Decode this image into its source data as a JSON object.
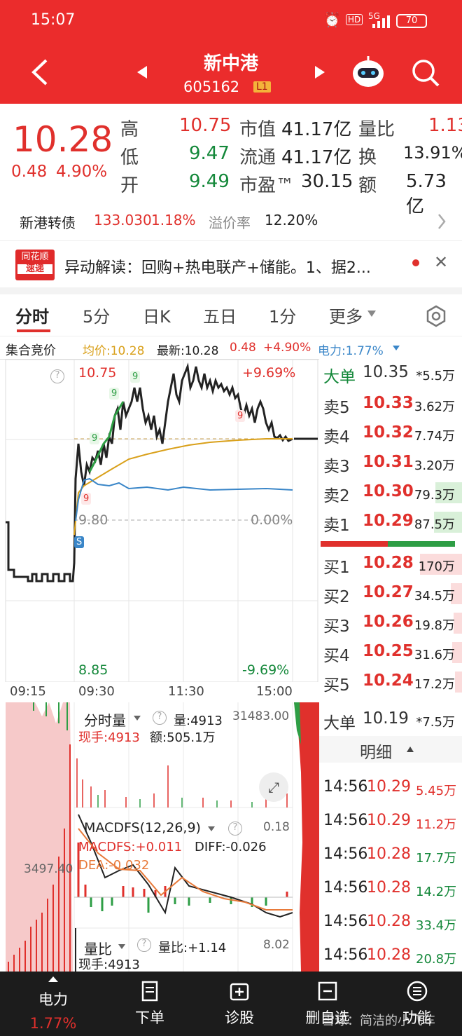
{
  "status": {
    "time": "15:07",
    "hd": "HD",
    "net": "5G",
    "battery": "70"
  },
  "nav": {
    "name": "新中港",
    "code": "605162",
    "level": "L1"
  },
  "quote": {
    "price": "10.28",
    "change": "0.48",
    "pct": "4.90%",
    "high_l": "高",
    "high": "10.75",
    "low_l": "低",
    "low": "9.47",
    "open_l": "开",
    "open": "9.49",
    "mcap_l": "市值",
    "mcap": "41.17亿",
    "float_l": "流通",
    "float": "41.17亿",
    "pe_l": "市盈™",
    "pe": "30.15",
    "vr_l": "量比",
    "vr": "1.13",
    "turn_l": "换",
    "turn": "13.91%",
    "amt_l": "额",
    "amt": "5.73亿"
  },
  "cb": {
    "name": "新港转债",
    "price": "133.030",
    "pct": "1.18%",
    "prem_l": "溢价率",
    "prem": "12.20%"
  },
  "news": {
    "logo1": "同花顺",
    "logo2": "速递",
    "text": "异动解读：回购+热电联产+储能。1、据2..."
  },
  "tabs": [
    "分时",
    "5分",
    "日K",
    "五日",
    "1分",
    "更多"
  ],
  "info": {
    "auction": "集合竞价",
    "avg": "均价:10.28",
    "last": "最新:10.28",
    "chg": "0.48",
    "pct": "+4.90%",
    "power": "电力:1.77%"
  },
  "chart": {
    "high": "10.75",
    "high_pct": "+9.69%",
    "pre": "9.80",
    "pre_pct": "0.00%",
    "low": "8.85",
    "low_pct": "-9.69%",
    "t": [
      "09:15",
      "09:30",
      "11:30",
      "15:00"
    ]
  },
  "vol": {
    "title": "分时量",
    "vol": "量:4913",
    "vmax": "31483.00",
    "hand": "现手:4913",
    "amt": "额:505.1万"
  },
  "macd": {
    "title": "MACDFS(12,26,9)",
    "top": "0.18",
    "macd": "MACDFS:+0.011",
    "diff": "DIFF:-0.026",
    "dea": "DEA:-0.032"
  },
  "vr": {
    "title": "量比",
    "val": "量比:+1.14",
    "top": "8.02",
    "hand": "现手:4913",
    "left": "3497.40"
  },
  "book": {
    "big_sell": {
      "label": "大单",
      "price": "10.35",
      "vol": "*5.5万"
    },
    "asks": [
      {
        "l": "卖5",
        "p": "10.33",
        "v": "3.62万"
      },
      {
        "l": "卖4",
        "p": "10.32",
        "v": "7.74万"
      },
      {
        "l": "卖3",
        "p": "10.31",
        "v": "3.20万"
      },
      {
        "l": "卖2",
        "p": "10.30",
        "v": "79.3万"
      },
      {
        "l": "卖1",
        "p": "10.29",
        "v": "87.5万"
      }
    ],
    "bids": [
      {
        "l": "买1",
        "p": "10.28",
        "v": "170万"
      },
      {
        "l": "买2",
        "p": "10.27",
        "v": "34.5万"
      },
      {
        "l": "买3",
        "p": "10.26",
        "v": "19.8万"
      },
      {
        "l": "买4",
        "p": "10.25",
        "v": "31.6万"
      },
      {
        "l": "买5",
        "p": "10.24",
        "v": "17.2万"
      }
    ],
    "big_buy": {
      "label": "大单",
      "price": "10.19",
      "vol": "*7.5万"
    },
    "detail": "明细",
    "trades": [
      {
        "t": "14:56",
        "p": "10.29",
        "v": "5.45万"
      },
      {
        "t": "14:56",
        "p": "10.29",
        "v": "11.2万"
      },
      {
        "t": "14:56",
        "p": "10.28",
        "v": "17.7万"
      },
      {
        "t": "14:56",
        "p": "10.28",
        "v": "14.2万"
      },
      {
        "t": "14:56",
        "p": "10.28",
        "v": "33.4万"
      },
      {
        "t": "14:56",
        "p": "10.28",
        "v": "20.8万"
      }
    ]
  },
  "bottom": {
    "power": "电力",
    "power_v": "1.77%",
    "order": "下单",
    "diag": "诊股",
    "del": "删自选",
    "func": "功能",
    "watermark": "雪球：简洁的小飞车"
  },
  "colors": {
    "brand": "#eb2c2c",
    "up": "#e0302c",
    "down": "#14883a",
    "avg": "#d9a01a",
    "blue": "#3a86c8"
  }
}
